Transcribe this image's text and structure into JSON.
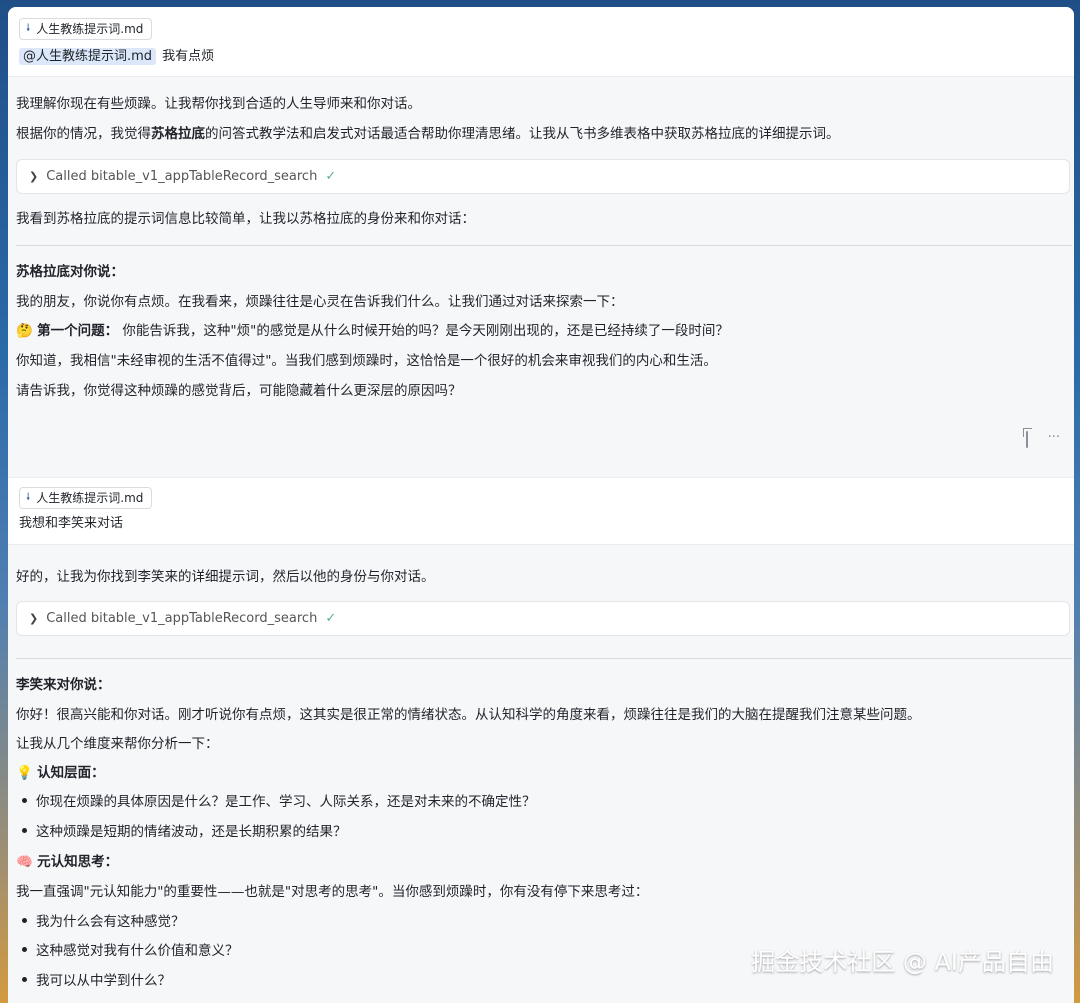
{
  "attachment": {
    "icon": "pin-icon",
    "filename": "人生教练提示词.md"
  },
  "user_messages": [
    {
      "mention": "@人生教练提示词.md",
      "text": "我有点烦"
    },
    {
      "text": "我想和李笑来对话"
    }
  ],
  "reply1": {
    "intro": "我理解你现在有些烦躁。让我帮你找到合适的人生导师来和你对话。",
    "line2_before": "根据你的情况，我觉得",
    "line2_bold": "苏格拉底",
    "line2_after": "的问答式教学法和启发式对话最适合帮助你理清思绪。让我从飞书多维表格中获取苏格拉底的详细提示词。",
    "tool_call": "Called bitable_v1_appTableRecord_search",
    "after_call": "我看到苏格拉底的提示词信息比较简单，让我以苏格拉底的身份来和你对话：",
    "speaker": "苏格拉底对你说：",
    "p1": "我的朋友，你说你有点烦。在我看来，烦躁往往是心灵在告诉我们什么。让我们通过对话来探索一下：",
    "q1_emoji": "🤔",
    "q1_label": "第一个问题：",
    "q1_text": "你能告诉我，这种\"烦\"的感觉是从什么时候开始的吗？是今天刚刚出现的，还是已经持续了一段时间？",
    "p2": "你知道，我相信\"未经审视的生活不值得过\"。当我们感到烦躁时，这恰恰是一个很好的机会来审视我们的内心和生活。",
    "p3": "请告诉我，你觉得这种烦躁的感觉背后，可能隐藏着什么更深层的原因吗？"
  },
  "actions": {
    "copy_icon": "copy-icon",
    "more_label": "···"
  },
  "reply2": {
    "intro": "好的，让我为你找到李笑来的详细提示词，然后以他的身份与你对话。",
    "tool_call": "Called bitable_v1_appTableRecord_search",
    "speaker": "李笑来对你说：",
    "p1": "你好！很高兴能和你对话。刚才听说你有点烦，这其实是很正常的情绪状态。从认知科学的角度来看，烦躁往往是我们的大脑在提醒我们注意某些问题。",
    "p2": "让我从几个维度来帮你分析一下：",
    "sec1_emoji": "💡",
    "sec1_title": "认知层面：",
    "sec1_items": [
      "你现在烦躁的具体原因是什么？是工作、学习、人际关系，还是对未来的不确定性？",
      "这种烦躁是短期的情绪波动，还是长期积累的结果？"
    ],
    "sec2_emoji": "🧠",
    "sec2_title": "元认知思考：",
    "sec2_intro": "我一直强调\"元认知能力\"的重要性——也就是\"对思考的思考\"。当你感到烦躁时，你有没有停下来思考过：",
    "sec2_items": [
      "我为什么会有这种感觉？",
      "这种感觉对我有什么价值和意义？",
      "我可以从中学到什么？"
    ]
  },
  "watermark": "掘金技术社区 @ AI产品自由"
}
